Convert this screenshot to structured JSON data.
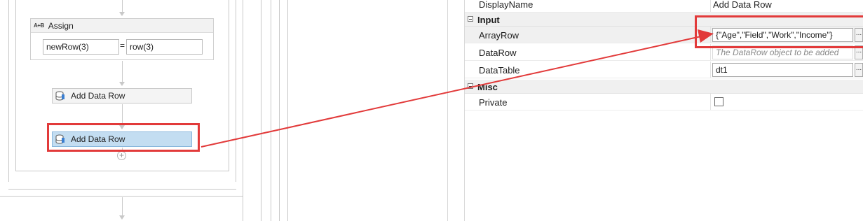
{
  "designer": {
    "assign": {
      "title": "Assign",
      "icon_text": "A+B",
      "left_operand": "newRow(3)",
      "equals": "=",
      "right_operand": "row(3)"
    },
    "activities": [
      {
        "label": "Add Data Row"
      },
      {
        "label": "Add Data Row"
      }
    ],
    "add_symbol": "+"
  },
  "properties": {
    "displayname": {
      "name": "DisplayName",
      "value": "Add Data Row"
    },
    "input_category": {
      "label": "Input"
    },
    "arrayrow": {
      "name": "ArrayRow",
      "value": "{\"Age\",\"Field\",\"Work\",\"Income\"}"
    },
    "datarow": {
      "name": "DataRow",
      "placeholder": "The DataRow object to be added"
    },
    "datatable": {
      "name": "DataTable",
      "value": "dt1"
    },
    "misc_category": {
      "label": "Misc"
    },
    "private": {
      "name": "Private",
      "checked": false
    },
    "ellipsis_label": "..."
  },
  "colors": {
    "annotation_red": "#e23a3a",
    "selected_activity": "#c3ddf1"
  }
}
